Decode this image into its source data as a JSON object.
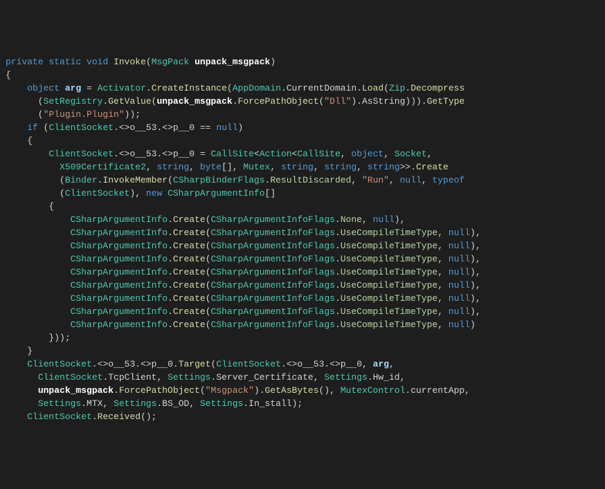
{
  "signature": {
    "kw_private": "private",
    "kw_static": "static",
    "kw_void": "void",
    "name": "Invoke",
    "param_type": "MsgPack",
    "param_name": "unpack_msgpack"
  },
  "line_obj": {
    "kw_object": "object",
    "var": "arg",
    "Activator": "Activator",
    "CreateInstance": "CreateInstance",
    "AppDomain": "AppDomain",
    "CurrentDomain": "CurrentDomain",
    "Load": "Load",
    "Zip": "Zip",
    "Decompress": "Decompress",
    "SetRegistry": "SetRegistry",
    "GetValue": "GetValue",
    "unpack": "unpack_msgpack",
    "ForcePathObject": "ForcePathObject",
    "str_dll": "\"Dll\"",
    "AsString": "AsString",
    "GetType": "GetType",
    "str_plugin": "\"Plugin.Plugin\""
  },
  "line_if": {
    "kw_if": "if",
    "ClientSocket": "ClientSocket",
    "o53": "<>o__53",
    "p0": "<>p__0",
    "kw_null": "null"
  },
  "callsite": {
    "CallSite": "CallSite",
    "Action": "Action",
    "obj": "object",
    "Socket": "Socket",
    "X509": "X509Certificate2",
    "string": "string",
    "byte": "byte",
    "Mutex": "Mutex",
    "Create": "Create",
    "Binder": "Binder",
    "InvokeMember": "InvokeMember",
    "CSharpBinderFlags": "CSharpBinderFlags",
    "ResultDiscarded": "ResultDiscarded",
    "str_run": "\"Run\"",
    "null": "null",
    "typeof": "typeof",
    "ClientSocket": "ClientSocket",
    "new": "new",
    "CSharpArgumentInfo": "CSharpArgumentInfo"
  },
  "args": {
    "CSharpArgumentInfo": "CSharpArgumentInfo",
    "Create": "Create",
    "Flags": "CSharpArgumentInfoFlags",
    "None": "None",
    "Use": "UseCompileTimeType",
    "null": "null"
  },
  "target": {
    "ClientSocket": "ClientSocket",
    "o53": "<>o__53",
    "p0": "<>p__0",
    "Target": "Target",
    "arg": "arg",
    "TcpClient": "TcpClient",
    "Settings": "Settings",
    "Server_Certificate": "Server_Certificate",
    "Hw_id": "Hw_id",
    "unpack": "unpack_msgpack",
    "ForcePathObject": "ForcePathObject",
    "str_msgpack": "\"Msgpack\"",
    "GetAsBytes": "GetAsBytes",
    "MutexControl": "MutexControl",
    "currentApp": "currentApp",
    "MTX": "MTX",
    "BS_OD": "BS_OD",
    "In_stall": "In_stall",
    "Received": "Received"
  }
}
